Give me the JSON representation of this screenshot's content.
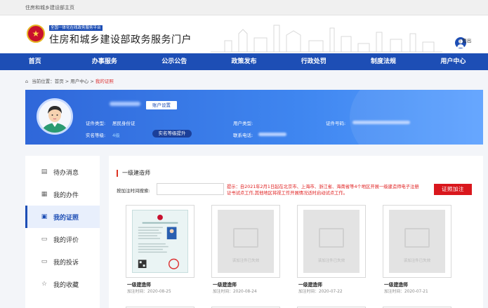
{
  "topbar": {
    "text": "住房和城乡建设部主页"
  },
  "header": {
    "tag": "全国一体化在线政务服务平台",
    "title": "住房和城乡建设部政务服务门户",
    "login": "| 登出"
  },
  "nav": {
    "items": [
      "首页",
      "办事服务",
      "公示公告",
      "政策发布",
      "行政处罚",
      "制度法规",
      "用户中心"
    ]
  },
  "breadcrumb": {
    "prefix": "当前位置：",
    "path": "首页 > 用户中心 > ",
    "current": "我的证照"
  },
  "profile": {
    "account_button": "账户设置",
    "id_type_label": "证件类型:",
    "id_type_value": "居民身份证",
    "realname_label": "实名等级:",
    "realname_value": "4级",
    "upgrade_button": "实名等级提升",
    "user_type_label": "用户类型:",
    "phone_label": "联系电话:",
    "id_number_label": "证件号码:"
  },
  "sidebar": {
    "items": [
      {
        "label": "待办消息",
        "icon": "inbox-icon"
      },
      {
        "label": "我的办件",
        "icon": "folder-icon"
      },
      {
        "label": "我的证照",
        "icon": "id-card-icon"
      },
      {
        "label": "我的评价",
        "icon": "comment-icon"
      },
      {
        "label": "我的投诉",
        "icon": "complaint-icon"
      },
      {
        "label": "我的收藏",
        "icon": "star-icon"
      }
    ],
    "active_index": 2
  },
  "main": {
    "section_title": "一级建造师",
    "search_label": "按加注时间搜索:",
    "search_value": "",
    "notice": "提示：自2021年2月1日起在北京市、上海市、浙江省、海南省等4个地区开展一级建造师电子注册证书试点工作,其他地区将视工作开展情况适时启动试点工作。",
    "add_button": "证照加注",
    "placeholder_text": "该加注件已失效",
    "cards": [
      {
        "name": "一级建造师",
        "date": "加注时间：2020-08-25",
        "has_image": true
      },
      {
        "name": "一级建造师",
        "date": "加注时间：2020-08-24",
        "has_image": false
      },
      {
        "name": "一级建造师",
        "date": "加注时间：2020-07-22",
        "has_image": false
      },
      {
        "name": "一级建造师",
        "date": "加注时间：2020-07-21",
        "has_image": false
      }
    ]
  },
  "colors": {
    "primary": "#1d4eb5",
    "accent_red": "#d9171d",
    "banner_start": "#2f67d9",
    "banner_end": "#5aa0ff"
  }
}
